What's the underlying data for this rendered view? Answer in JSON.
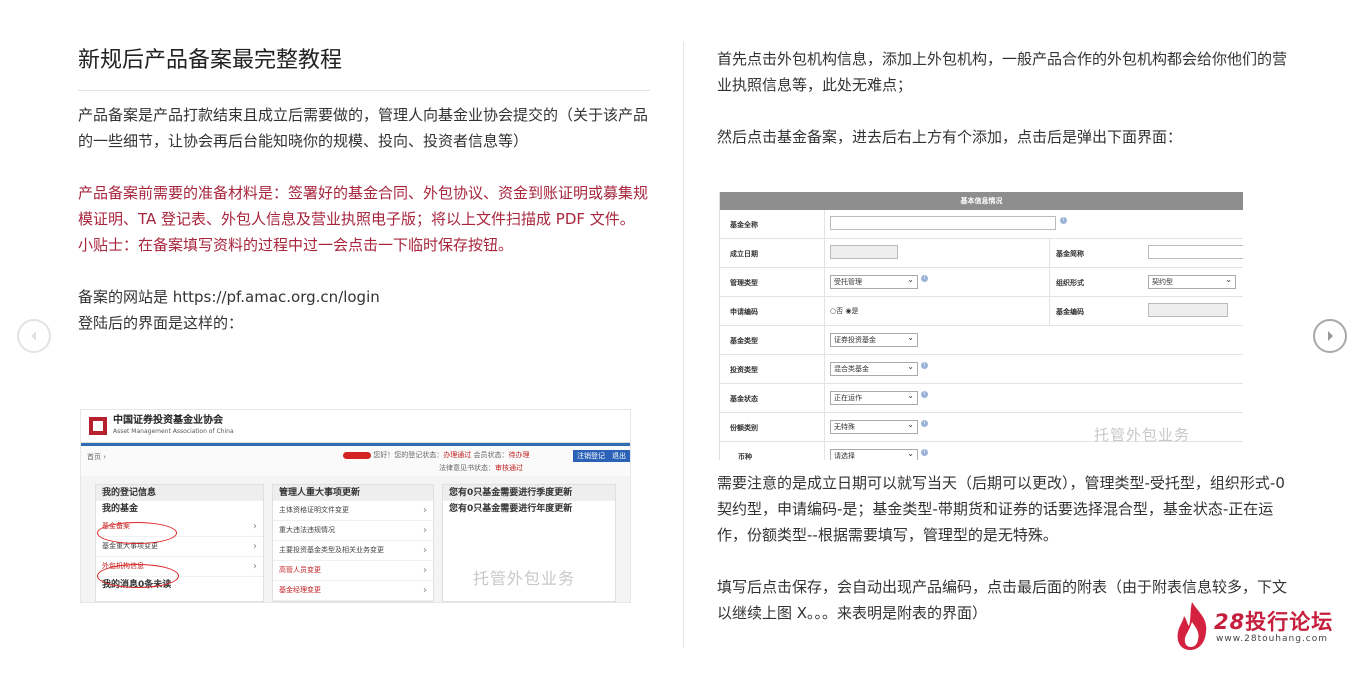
{
  "left": {
    "title": "新规后产品备案最完整教程",
    "p1": "产品备案是产品打款结束且成立后需要做的，管理人向基金业协会提交的（关于该产品的一些细节，让协会再后台能知晓你的规模、投向、投资者信息等）",
    "p2": "产品备案前需要的准备材料是：签署好的基金合同、外包协议、资金到账证明或募集规模证明、TA 登记表、外包人信息及营业执照电子版；将以上文件扫描成 PDF 文件。",
    "p3": "小贴士：在备案填写资料的过程中过一会点击一下临时保存按钮。",
    "p4": "备案的网站是 https://pf.amac.org.cn/login",
    "p5": "登陆后的界面是这样的："
  },
  "screenshot1": {
    "org_cn": "中国证券投资基金业协会",
    "org_en": "Asset Management Association of China",
    "crumb": "首页  ›",
    "status_prefix": "您好！您的登记状态：",
    "status_1": "办理通过",
    "status_mid": " 会员状态：",
    "status_2": "待办理",
    "law": "法律意见书状态：",
    "law_status": "审核通过",
    "btn_logout": "注销登记",
    "btn_exit": "退出",
    "col1": {
      "head1": "我的登记信息",
      "head2": "我的基金",
      "items": [
        "基金备案",
        "基金重大事项变更",
        "外包机构信息"
      ],
      "head3": "我的消息0条未读"
    },
    "col2": {
      "head": "管理人重大事项更新",
      "items": [
        "主体资格证明文件变更",
        "重大违法违规情况",
        "主要投资基金类型及相关业务变更",
        "高管人员变更",
        "基金经理变更"
      ]
    },
    "col3": {
      "head1": "您有0只基金需要进行季度更新",
      "head2": "您有0只基金需要进行年度更新"
    },
    "watermark": "托管外包业务"
  },
  "right": {
    "p1": "首先点击外包机构信息，添加上外包机构，一般产品合作的外包机构都会给你他们的营业执照信息等，此处无难点；",
    "p2": "然后点击基金备案，进去后右上方有个添加，点击后是弹出下面界面：",
    "p3": "需要注意的是成立日期可以就写当天（后期可以更改），管理类型-受托型，组织形式-0 契约型，申请编码-是；基金类型-带期货和证券的话要选择混合型，基金状态-正在运作，份额类型--根据需要填写，管理型的是无特殊。",
    "p4": "填写后点击保存，会自动出现产品编码，点击最后面的附表（由于附表信息较多，下文以继续上图 X。。。来表明是附表的界面）"
  },
  "screenshot2": {
    "head": "基本信息情况",
    "rows": {
      "fund_name": "基金全称",
      "setup_date": "成立日期",
      "fund_short": "基金简称",
      "mgmt_type": "管理类型",
      "mgmt_val": "受托管理",
      "org_form": "组织形式",
      "org_val": "契约型",
      "apply_code": "申请编码",
      "apply_no": "否",
      "apply_yes": "是",
      "fund_code": "基金编码",
      "fund_type": "基金类型",
      "fund_type_val": "证券投资基金",
      "invest_type": "投资类型",
      "invest_val": "混合类基金",
      "fund_status": "基金状态",
      "status_val": "正在运作",
      "share_type": "份额类别",
      "share_val": "无特殊",
      "currency": "币种",
      "currency_val": "请选择"
    },
    "watermark": "托管外包业务"
  },
  "logo": {
    "text_num": "28",
    "text_cn": "投行论坛",
    "url": "www.28touhang.com",
    "color": "#c51f3d"
  }
}
